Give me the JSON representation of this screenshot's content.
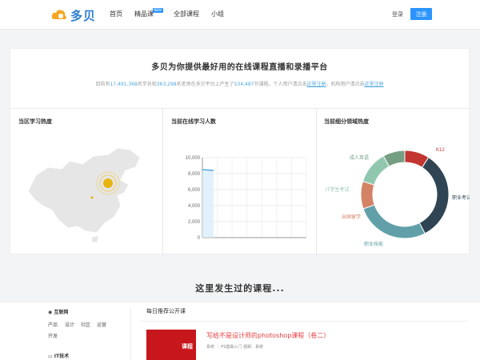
{
  "header": {
    "logo_text": "多贝",
    "nav": [
      {
        "label": "首页"
      },
      {
        "label": "精品课",
        "badge": "NEW"
      },
      {
        "label": "全部课程"
      },
      {
        "label": "小组"
      }
    ],
    "login_label": "登录",
    "register_label": "注册"
  },
  "hero": {
    "title": "多贝为你提供最好用的在线课程直播和录播平台",
    "sub_prefix": "目前有",
    "students": "17,491,368",
    "sub_mid1": "名学员和",
    "teachers": "363,298",
    "sub_mid2": "名老师在多贝平台上产生了",
    "courses": "534,487",
    "sub_mid3": "节课程。个人用户请点击",
    "link1": "这里注册",
    "sub_mid4": "，机构用户请点击",
    "link2": "这里注册"
  },
  "panels": {
    "map_title": "当区学习热度",
    "online_title": "当前在线学习人数",
    "domain_title": "当前细分领域热度"
  },
  "chart_data": [
    {
      "type": "line",
      "title": "当前在线学习人数",
      "y_ticks": [
        "10,000",
        "8,000",
        "6,000",
        "4,000",
        "2,000",
        "0"
      ],
      "ylim": [
        0,
        10000
      ],
      "x": [
        0,
        1
      ],
      "values": [
        8500,
        8400
      ]
    },
    {
      "type": "pie",
      "title": "当前细分领域热度",
      "series": [
        {
          "label": "K12",
          "value": 9,
          "color": "#c23531"
        },
        {
          "label": "职业考试",
          "value": 33,
          "color": "#2f4554"
        },
        {
          "label": "职业技能",
          "value": 27,
          "color": "#61a0a8"
        },
        {
          "label": "出国留学",
          "value": 10,
          "color": "#d48265"
        },
        {
          "label": "IT学生考试",
          "value": 12,
          "color": "#91c7ae"
        },
        {
          "label": "成人英语",
          "value": 8,
          "color": "#749f83"
        }
      ]
    }
  ],
  "section_title": "这里发生过的课程...",
  "categories": {
    "internet_head": "互联网",
    "internet_items": [
      "产品",
      "设计",
      "社区",
      "运营",
      "开发"
    ],
    "it_head": "IT技术"
  },
  "recommend": {
    "title": "每日推荐公开课",
    "course_title": "写给不是设计师的photoshop课程（卷二）",
    "course_meta": "系统 ｜ PS基础入门 视频：系统",
    "thumb_text": "课程"
  }
}
